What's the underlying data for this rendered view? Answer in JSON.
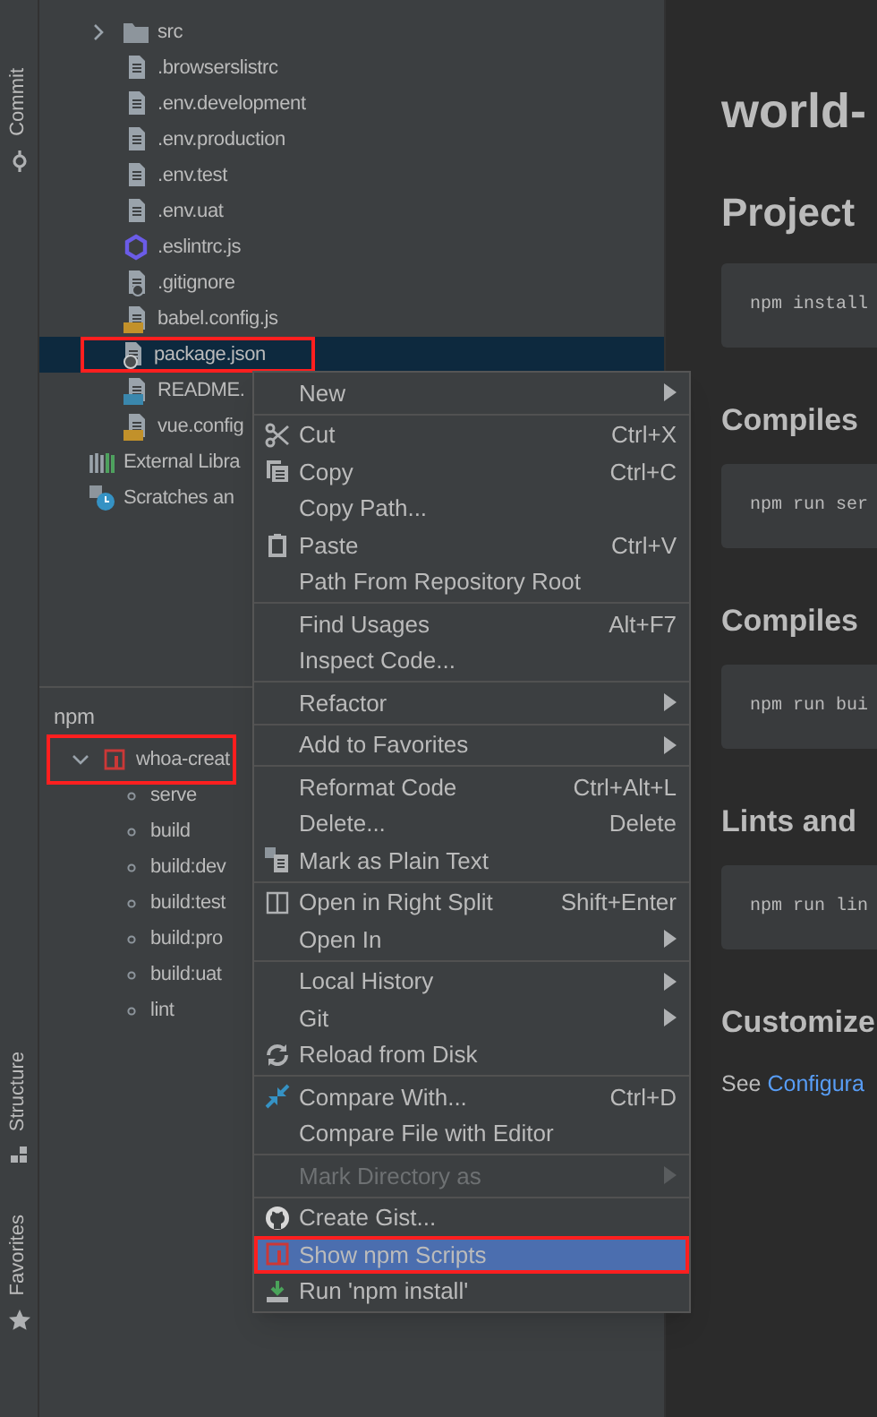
{
  "tool_strip": {
    "top": [
      {
        "label": "Commit",
        "kind": "commit"
      }
    ],
    "bottom": [
      {
        "label": "Structure",
        "kind": "structure"
      },
      {
        "label": "Favorites",
        "kind": "favorites"
      }
    ]
  },
  "project_tree": {
    "items": [
      {
        "label": "src",
        "kind": "folder",
        "expanded": false,
        "selected": false,
        "highlighted": false
      },
      {
        "label": ".browserslistrc",
        "kind": "file",
        "selected": false,
        "highlighted": false
      },
      {
        "label": ".env.development",
        "kind": "file",
        "selected": false,
        "highlighted": false
      },
      {
        "label": ".env.production",
        "kind": "file",
        "selected": false,
        "highlighted": false
      },
      {
        "label": ".env.test",
        "kind": "file",
        "selected": false,
        "highlighted": false
      },
      {
        "label": ".env.uat",
        "kind": "file",
        "selected": false,
        "highlighted": false
      },
      {
        "label": ".eslintrc.js",
        "kind": "eslint",
        "selected": false,
        "highlighted": false
      },
      {
        "label": ".gitignore",
        "kind": "ignore",
        "selected": false,
        "highlighted": false
      },
      {
        "label": "babel.config.js",
        "kind": "js",
        "selected": false,
        "highlighted": false
      },
      {
        "label": "package.json",
        "kind": "json",
        "selected": true,
        "highlighted": true
      },
      {
        "label": "README.",
        "kind": "md",
        "selected": false,
        "highlighted": false
      },
      {
        "label": "vue.config",
        "kind": "js",
        "selected": false,
        "highlighted": false
      },
      {
        "label": "External Libra",
        "kind": "libraries",
        "selected": false,
        "highlighted": false
      },
      {
        "label": "Scratches an",
        "kind": "scratches",
        "selected": false,
        "highlighted": false
      }
    ]
  },
  "npm_panel": {
    "title": "npm",
    "root": {
      "label": "whoa-creat",
      "expanded": true,
      "highlighted": true,
      "children": [
        "serve",
        "build",
        "build:dev",
        "build:test",
        "build:pro",
        "build:uat",
        "lint"
      ]
    }
  },
  "context_menu": {
    "groups": [
      [
        {
          "label": "New",
          "kind": "none",
          "submenu": true,
          "disabled": false,
          "selected": false,
          "highlighted": false
        }
      ],
      [
        {
          "label": "Cut",
          "shortcut": "Ctrl+X",
          "kind": "scissors",
          "submenu": false,
          "disabled": false,
          "selected": false,
          "highlighted": false
        },
        {
          "label": "Copy",
          "shortcut": "Ctrl+C",
          "kind": "copy",
          "submenu": false,
          "disabled": false,
          "selected": false,
          "highlighted": false
        },
        {
          "label": "Copy Path...",
          "kind": "none",
          "submenu": false,
          "disabled": false,
          "selected": false,
          "highlighted": false
        },
        {
          "label": "Paste",
          "shortcut": "Ctrl+V",
          "kind": "paste",
          "submenu": false,
          "disabled": false,
          "selected": false,
          "highlighted": false
        },
        {
          "label": "Path From Repository Root",
          "kind": "none",
          "submenu": false,
          "disabled": false,
          "selected": false,
          "highlighted": false
        }
      ],
      [
        {
          "label": "Find Usages",
          "shortcut": "Alt+F7",
          "kind": "none",
          "submenu": false,
          "disabled": false,
          "selected": false,
          "highlighted": false
        },
        {
          "label": "Inspect Code...",
          "kind": "none",
          "submenu": false,
          "disabled": false,
          "selected": false,
          "highlighted": false
        }
      ],
      [
        {
          "label": "Refactor",
          "kind": "none",
          "submenu": true,
          "disabled": false,
          "selected": false,
          "highlighted": false
        }
      ],
      [
        {
          "label": "Add to Favorites",
          "kind": "none",
          "submenu": true,
          "disabled": false,
          "selected": false,
          "highlighted": false
        }
      ],
      [
        {
          "label": "Reformat Code",
          "shortcut": "Ctrl+Alt+L",
          "kind": "none",
          "submenu": false,
          "disabled": false,
          "selected": false,
          "highlighted": false
        },
        {
          "label": "Delete...",
          "shortcut": "Delete",
          "kind": "none",
          "submenu": false,
          "disabled": false,
          "selected": false,
          "highlighted": false
        },
        {
          "label": "Mark as Plain Text",
          "kind": "plaintext",
          "submenu": false,
          "disabled": false,
          "selected": false,
          "highlighted": false
        }
      ],
      [
        {
          "label": "Open in Right Split",
          "shortcut": "Shift+Enter",
          "kind": "split",
          "submenu": false,
          "disabled": false,
          "selected": false,
          "highlighted": false
        },
        {
          "label": "Open In",
          "kind": "none",
          "submenu": true,
          "disabled": false,
          "selected": false,
          "highlighted": false
        }
      ],
      [
        {
          "label": "Local History",
          "kind": "none",
          "submenu": true,
          "disabled": false,
          "selected": false,
          "highlighted": false
        },
        {
          "label": "Git",
          "kind": "none",
          "submenu": true,
          "disabled": false,
          "selected": false,
          "highlighted": false
        },
        {
          "label": "Reload from Disk",
          "kind": "reload",
          "submenu": false,
          "disabled": false,
          "selected": false,
          "highlighted": false
        }
      ],
      [
        {
          "label": "Compare With...",
          "shortcut": "Ctrl+D",
          "kind": "compare",
          "submenu": false,
          "disabled": false,
          "selected": false,
          "highlighted": false
        },
        {
          "label": "Compare File with Editor",
          "kind": "none",
          "submenu": false,
          "disabled": false,
          "selected": false,
          "highlighted": false
        }
      ],
      [
        {
          "label": "Mark Directory as",
          "kind": "none",
          "submenu": true,
          "disabled": true,
          "selected": false,
          "highlighted": false
        }
      ],
      [
        {
          "label": "Create Gist...",
          "kind": "github",
          "submenu": false,
          "disabled": false,
          "selected": false,
          "highlighted": false
        },
        {
          "label": "Show npm Scripts",
          "kind": "npm",
          "submenu": false,
          "disabled": false,
          "selected": true,
          "highlighted": true
        },
        {
          "label": "Run 'npm install'",
          "kind": "install",
          "submenu": false,
          "disabled": false,
          "selected": false,
          "highlighted": false
        }
      ]
    ]
  },
  "preview": {
    "blocks": [
      {
        "kind": "h1",
        "text": "world-"
      },
      {
        "kind": "h2",
        "text": "Project"
      },
      {
        "kind": "code",
        "text": "npm install"
      },
      {
        "kind": "h3",
        "text": "Compiles"
      },
      {
        "kind": "code",
        "text": "npm run ser"
      },
      {
        "kind": "h3",
        "text": "Compiles"
      },
      {
        "kind": "code",
        "text": "npm run bui"
      },
      {
        "kind": "h3",
        "text": "Lints and"
      },
      {
        "kind": "code",
        "text": "npm run lin"
      },
      {
        "kind": "h3",
        "text": "Customize"
      },
      {
        "kind": "para",
        "text": "See ",
        "link": "Configura"
      }
    ]
  }
}
